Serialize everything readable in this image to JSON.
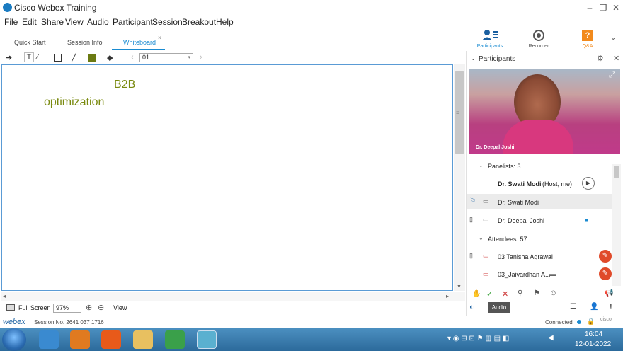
{
  "app": {
    "title": "Cisco Webex Training"
  },
  "menu": [
    "File",
    "Edit",
    "Share",
    "View",
    "Audio",
    "Participant",
    "Session",
    "Breakout",
    "Help"
  ],
  "tabs": [
    {
      "label": "Quick Start"
    },
    {
      "label": "Session Info"
    },
    {
      "label": "Whiteboard",
      "active": true
    }
  ],
  "right_toolbar": {
    "participants": "Participants",
    "recorder": "Recorder",
    "qa": "Q&A"
  },
  "whiteboard": {
    "page": "01",
    "texts": [
      "B2B",
      "optimization"
    ],
    "text_color": "#7a8a10"
  },
  "bottom": {
    "full_screen": "Full Screen",
    "zoom": "97%",
    "view": "View"
  },
  "status": {
    "session": "Session No. 2641 037 1716",
    "connected": "Connected",
    "brand": "webex"
  },
  "panel": {
    "title": "Participants",
    "video_name": "Dr. Deepal Joshi",
    "panelists_label": "Panelists: 3",
    "host_name": "Dr. Swati Modi",
    "host_role": "(Host, me)",
    "panelists": [
      "Dr. Swati Modi",
      "Dr. Deepal Joshi"
    ],
    "attendees_label": "Attendees: 57",
    "attendees": [
      "03 Tanisha Agrawal",
      "03_Jaivardhan A..."
    ],
    "audio_tooltip": "Audio"
  },
  "taskbar": {
    "time": "16:04",
    "date": "12-01-2022"
  },
  "colors": {
    "accent": "#1a8bd1",
    "mute_red": "#e04a2a",
    "taskbar": "#3a7aab"
  }
}
